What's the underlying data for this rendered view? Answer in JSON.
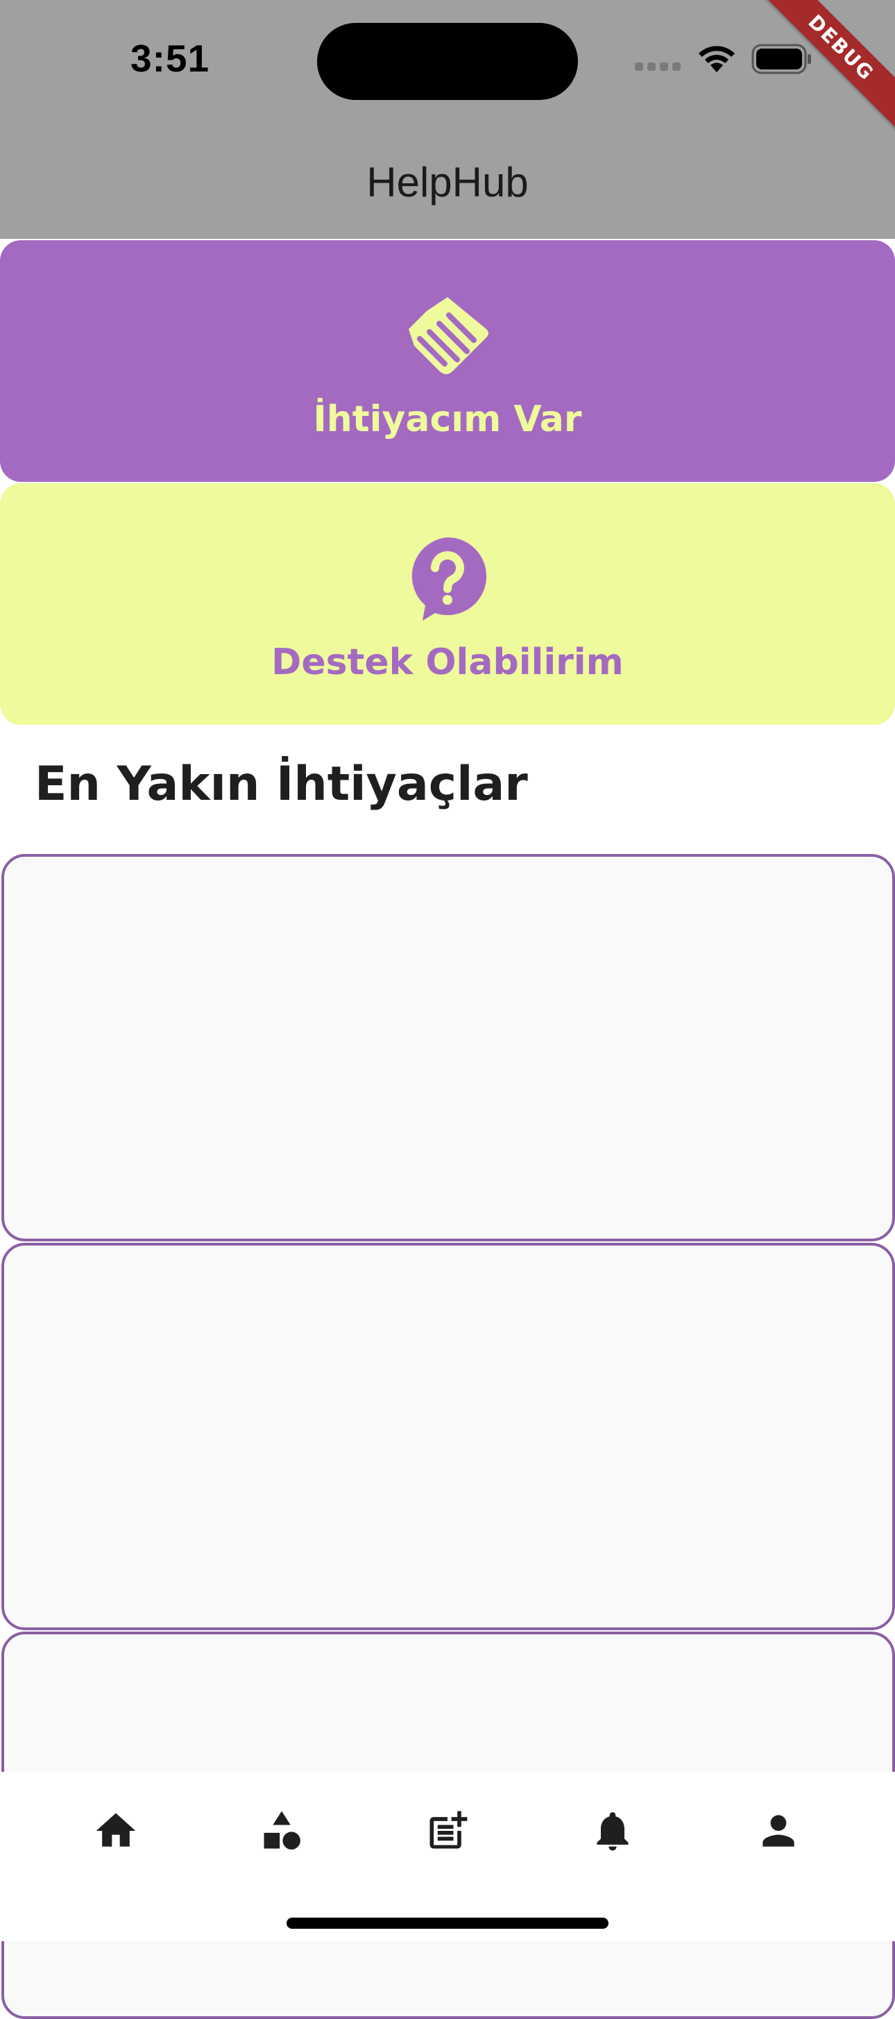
{
  "status_bar": {
    "time": "3:51",
    "debug_label": "DEBUG"
  },
  "app": {
    "title": "HelpHub"
  },
  "actions": {
    "need": {
      "label": "İhtiyacım Var",
      "icon": "handshake-icon",
      "background": "#a46ac1",
      "foreground": "#eefa9c"
    },
    "support": {
      "label": "Destek Olabilirim",
      "icon": "question-bubble-icon",
      "background": "#eefa9c",
      "foreground": "#a46ac1"
    }
  },
  "nearby": {
    "title": "En Yakın İhtiyaçlar"
  },
  "bottom_nav": {
    "items": [
      {
        "icon": "home-icon"
      },
      {
        "icon": "categories-icon"
      },
      {
        "icon": "post-add-icon"
      },
      {
        "icon": "notifications-icon"
      },
      {
        "icon": "profile-icon"
      }
    ]
  },
  "colors": {
    "appbar": "#a0a0a0",
    "card_border": "#8a5fa3",
    "card_fill": "#f9f9fa"
  }
}
